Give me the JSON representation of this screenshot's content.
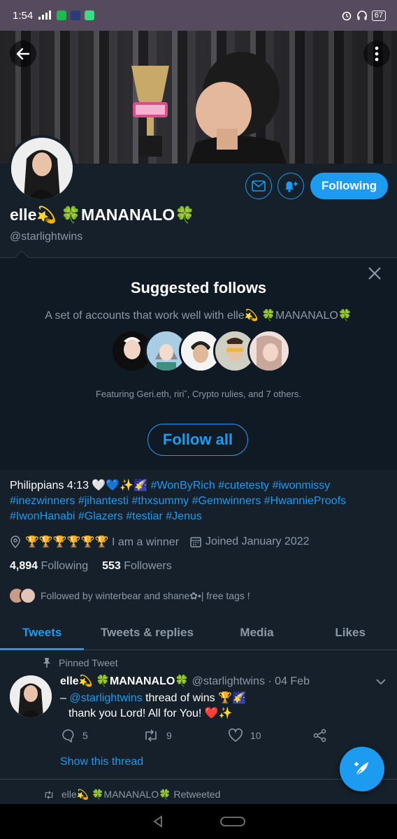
{
  "status_bar": {
    "time": "1:54",
    "battery": "67"
  },
  "profile": {
    "display_name": "elle💫 🍀MANANALO🍀",
    "handle": "@starlightwins",
    "following_label": "Following"
  },
  "suggested": {
    "title": "Suggested follows",
    "description": "A set of accounts that work well with elle💫 🍀MANANALO🍀",
    "featuring": "Featuring Geri.eth, riri˘, Crypto rulies, and 7 others.",
    "follow_all_label": "Follow all"
  },
  "bio": {
    "text": "Philippians 4:13 🤍💙✨🌠",
    "hashtags": [
      "#WonByRich",
      "#cutetesty",
      "#iwonmissy",
      "#inezwinners",
      "#jihantesti",
      "#thxsummy",
      "#Gemwinners",
      "#HwannieProofs",
      "#IwonHanabi",
      "#Glazers",
      "#testiar",
      "#Jenus"
    ]
  },
  "meta": {
    "location": "🏆🏆🏆🏆🏆🏆 I am a winner",
    "joined": "Joined January 2022"
  },
  "counts": {
    "following_count": "4,894",
    "following_label": "Following",
    "followers_count": "553",
    "followers_label": "Followers"
  },
  "followed_by": "Followed by winterbear and shane✿•| free tags !",
  "tabs": [
    {
      "label": "Tweets"
    },
    {
      "label": "Tweets & replies"
    },
    {
      "label": "Media"
    },
    {
      "label": "Likes"
    }
  ],
  "tweet": {
    "pinned_label": "Pinned Tweet",
    "name": "elle💫 🍀MANANALO🍀",
    "handle_date": "@starlightwins · 04 Feb",
    "line1_prefix": "– ",
    "mention": "@starlightwins",
    "line1_suffix": " thread of wins 🏆🌠",
    "line2": "thank you Lord! All for You! ❤️✨",
    "replies": "5",
    "retweets": "9",
    "likes": "10",
    "show_thread": "Show this thread"
  },
  "retweeted": {
    "name": "elle💫 🍀MANANALO🍀",
    "label": "Retweeted"
  },
  "colors": {
    "accent": "#1d9bf0",
    "background": "#15202b",
    "secondary_text": "#8b98a5"
  }
}
